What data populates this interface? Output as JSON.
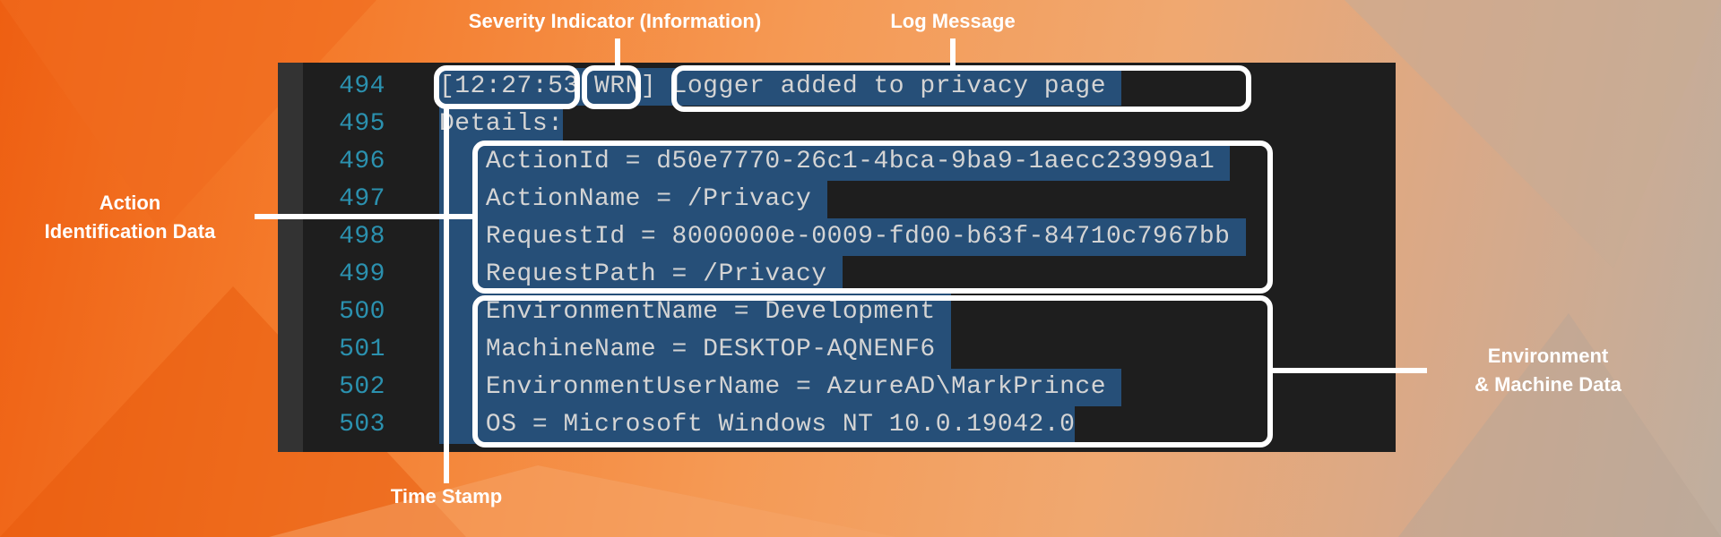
{
  "annotations": {
    "severity": "Severity Indicator (Information)",
    "log_message": "Log Message",
    "action_line1": "Action",
    "action_line2": "Identification Data",
    "env_line1": "Environment",
    "env_line2": "& Machine Data",
    "timestamp": "Time Stamp"
  },
  "colors": {
    "selection": "#264f78",
    "editor_bg": "#1e1e1e",
    "line_number": "#2b91af",
    "text": "#d4d4d4",
    "annotation": "#ffffff"
  },
  "lines": [
    {
      "num": "494",
      "text": "[12:27:53 WRN] Logger added to privacy page "
    },
    {
      "num": "495",
      "text": "Details:"
    },
    {
      "num": "496",
      "text": "   ActionId = d50e7770-26c1-4bca-9ba9-1aecc23999a1 "
    },
    {
      "num": "497",
      "text": "   ActionName = /Privacy "
    },
    {
      "num": "498",
      "text": "   RequestId = 8000000e-0009-fd00-b63f-84710c7967bb "
    },
    {
      "num": "499",
      "text": "   RequestPath = /Privacy "
    },
    {
      "num": "500",
      "text": "   EnvironmentName = Development "
    },
    {
      "num": "501",
      "text": "   MachineName = DESKTOP-AQNENF6 "
    },
    {
      "num": "502",
      "text": "   EnvironmentUserName = AzureAD\\MarkPrince "
    },
    {
      "num": "503",
      "text": "   OS = Microsoft Windows NT 10.0.19042.0"
    }
  ]
}
